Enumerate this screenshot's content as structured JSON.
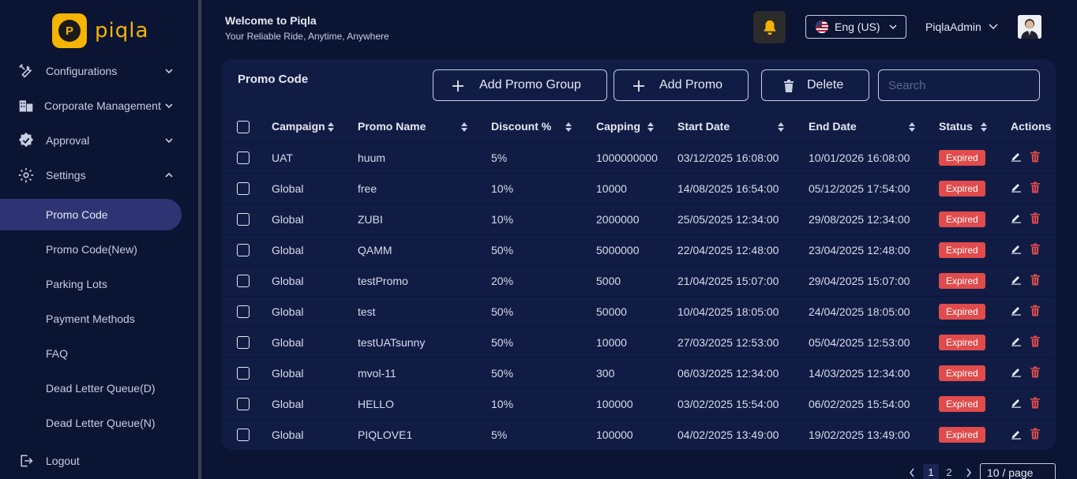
{
  "brand": {
    "name": "piqla",
    "logo_letter": "P"
  },
  "sidebar": {
    "items": [
      {
        "label": "Configurations"
      },
      {
        "label": "Corporate Management"
      },
      {
        "label": "Approval"
      },
      {
        "label": "Settings"
      }
    ],
    "sub_items": [
      {
        "label": "Promo Code"
      },
      {
        "label": "Promo Code(New)"
      },
      {
        "label": "Parking Lots"
      },
      {
        "label": "Payment Methods"
      },
      {
        "label": "FAQ"
      },
      {
        "label": "Dead Letter Queue(D)"
      },
      {
        "label": "Dead Letter Queue(N)"
      }
    ],
    "logout_label": "Logout"
  },
  "header": {
    "welcome_title": "Welcome to Piqla",
    "welcome_subtitle": "Your Reliable Ride, Anytime, Anywhere",
    "language": "Eng (US)",
    "user_name": "PiqlaAdmin"
  },
  "card": {
    "title": "Promo Code",
    "add_group_label": "Add Promo Group",
    "add_promo_label": "Add Promo",
    "delete_label": "Delete",
    "search_placeholder": "Search"
  },
  "table": {
    "columns": {
      "campaign": "Campaign",
      "promo_name": "Promo Name",
      "discount": "Discount %",
      "capping": "Capping",
      "start_date": "Start Date",
      "end_date": "End Date",
      "status": "Status",
      "actions": "Actions"
    },
    "rows": [
      {
        "campaign": "UAT",
        "promo_name": "huum",
        "discount": "5%",
        "capping": "1000000000",
        "start_date": "03/12/2025 16:08:00",
        "end_date": "10/01/2026 16:08:00",
        "status": "Expired"
      },
      {
        "campaign": "Global",
        "promo_name": "free",
        "discount": "10%",
        "capping": "10000",
        "start_date": "14/08/2025 16:54:00",
        "end_date": "05/12/2025 17:54:00",
        "status": "Expired"
      },
      {
        "campaign": "Global",
        "promo_name": "ZUBI",
        "discount": "10%",
        "capping": "2000000",
        "start_date": "25/05/2025 12:34:00",
        "end_date": "29/08/2025 12:34:00",
        "status": "Expired"
      },
      {
        "campaign": "Global",
        "promo_name": "QAMM",
        "discount": "50%",
        "capping": "5000000",
        "start_date": "22/04/2025 12:48:00",
        "end_date": "23/04/2025 12:48:00",
        "status": "Expired"
      },
      {
        "campaign": "Global",
        "promo_name": "testPromo",
        "discount": "20%",
        "capping": "5000",
        "start_date": "21/04/2025 15:07:00",
        "end_date": "29/04/2025 15:07:00",
        "status": "Expired"
      },
      {
        "campaign": "Global",
        "promo_name": "test",
        "discount": "50%",
        "capping": "50000",
        "start_date": "10/04/2025 18:05:00",
        "end_date": "24/04/2025 18:05:00",
        "status": "Expired"
      },
      {
        "campaign": "Global",
        "promo_name": "testUATsunny",
        "discount": "50%",
        "capping": "10000",
        "start_date": "27/03/2025 12:53:00",
        "end_date": "05/04/2025 12:53:00",
        "status": "Expired"
      },
      {
        "campaign": "Global",
        "promo_name": "mvol-11",
        "discount": "50%",
        "capping": "300",
        "start_date": "06/03/2025 12:34:00",
        "end_date": "14/03/2025 12:34:00",
        "status": "Expired"
      },
      {
        "campaign": "Global",
        "promo_name": "HELLO",
        "discount": "10%",
        "capping": "100000",
        "start_date": "03/02/2025 15:54:00",
        "end_date": "06/02/2025 15:54:00",
        "status": "Expired"
      },
      {
        "campaign": "Global",
        "promo_name": "PIQLOVE1",
        "discount": "5%",
        "capping": "100000",
        "start_date": "04/02/2025 13:49:00",
        "end_date": "19/02/2025 13:49:00",
        "status": "Expired"
      }
    ]
  },
  "pagination": {
    "pages": [
      "1",
      "2"
    ],
    "page_size": "10 / page"
  },
  "colors": {
    "background": "#0b1433",
    "card": "#111c45",
    "accent": "#f5b400",
    "active_nav": "#2e3473",
    "expired": "#e04b4b",
    "delete_icon": "#e04b4b"
  }
}
